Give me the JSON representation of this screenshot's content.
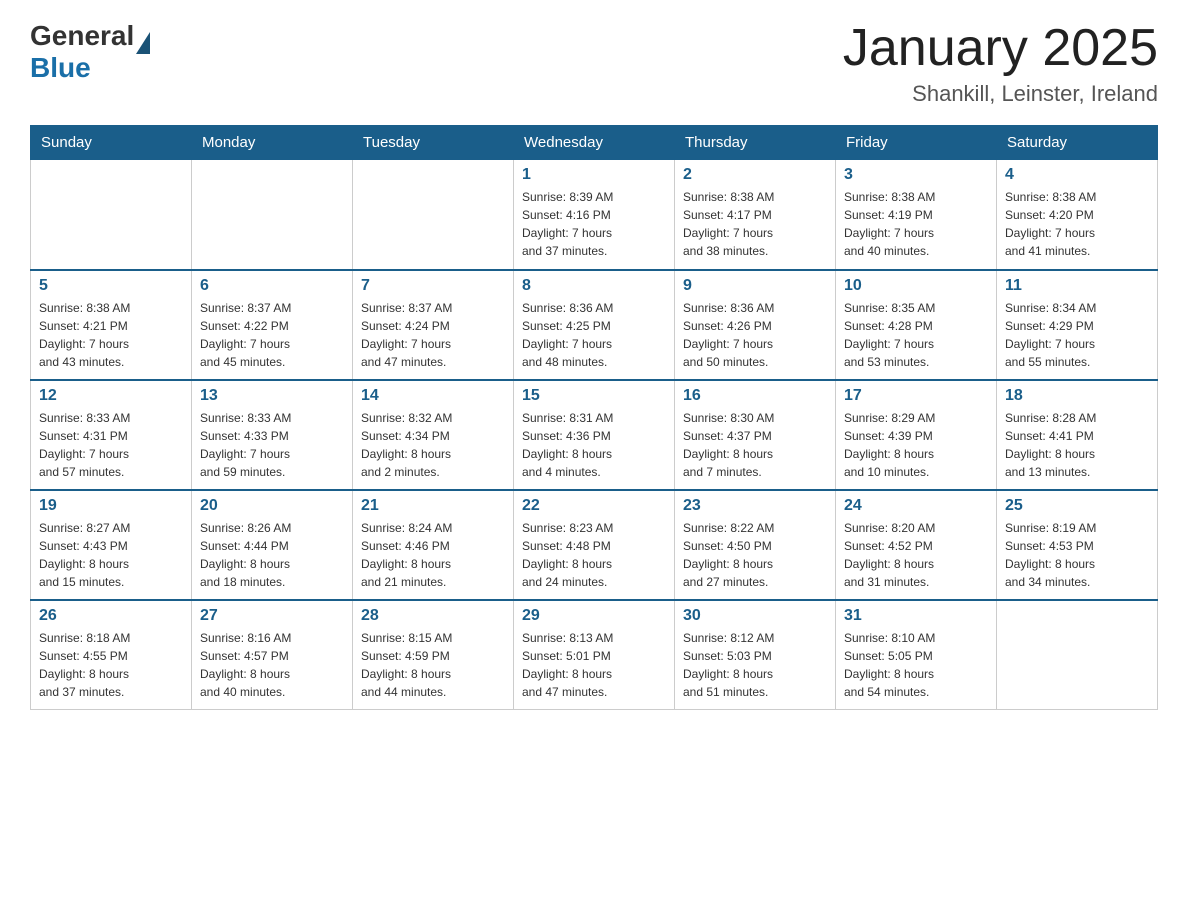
{
  "logo": {
    "general": "General",
    "blue": "Blue"
  },
  "title": "January 2025",
  "subtitle": "Shankill, Leinster, Ireland",
  "days_of_week": [
    "Sunday",
    "Monday",
    "Tuesday",
    "Wednesday",
    "Thursday",
    "Friday",
    "Saturday"
  ],
  "weeks": [
    [
      {
        "day": "",
        "info": ""
      },
      {
        "day": "",
        "info": ""
      },
      {
        "day": "",
        "info": ""
      },
      {
        "day": "1",
        "info": "Sunrise: 8:39 AM\nSunset: 4:16 PM\nDaylight: 7 hours\nand 37 minutes."
      },
      {
        "day": "2",
        "info": "Sunrise: 8:38 AM\nSunset: 4:17 PM\nDaylight: 7 hours\nand 38 minutes."
      },
      {
        "day": "3",
        "info": "Sunrise: 8:38 AM\nSunset: 4:19 PM\nDaylight: 7 hours\nand 40 minutes."
      },
      {
        "day": "4",
        "info": "Sunrise: 8:38 AM\nSunset: 4:20 PM\nDaylight: 7 hours\nand 41 minutes."
      }
    ],
    [
      {
        "day": "5",
        "info": "Sunrise: 8:38 AM\nSunset: 4:21 PM\nDaylight: 7 hours\nand 43 minutes."
      },
      {
        "day": "6",
        "info": "Sunrise: 8:37 AM\nSunset: 4:22 PM\nDaylight: 7 hours\nand 45 minutes."
      },
      {
        "day": "7",
        "info": "Sunrise: 8:37 AM\nSunset: 4:24 PM\nDaylight: 7 hours\nand 47 minutes."
      },
      {
        "day": "8",
        "info": "Sunrise: 8:36 AM\nSunset: 4:25 PM\nDaylight: 7 hours\nand 48 minutes."
      },
      {
        "day": "9",
        "info": "Sunrise: 8:36 AM\nSunset: 4:26 PM\nDaylight: 7 hours\nand 50 minutes."
      },
      {
        "day": "10",
        "info": "Sunrise: 8:35 AM\nSunset: 4:28 PM\nDaylight: 7 hours\nand 53 minutes."
      },
      {
        "day": "11",
        "info": "Sunrise: 8:34 AM\nSunset: 4:29 PM\nDaylight: 7 hours\nand 55 minutes."
      }
    ],
    [
      {
        "day": "12",
        "info": "Sunrise: 8:33 AM\nSunset: 4:31 PM\nDaylight: 7 hours\nand 57 minutes."
      },
      {
        "day": "13",
        "info": "Sunrise: 8:33 AM\nSunset: 4:33 PM\nDaylight: 7 hours\nand 59 minutes."
      },
      {
        "day": "14",
        "info": "Sunrise: 8:32 AM\nSunset: 4:34 PM\nDaylight: 8 hours\nand 2 minutes."
      },
      {
        "day": "15",
        "info": "Sunrise: 8:31 AM\nSunset: 4:36 PM\nDaylight: 8 hours\nand 4 minutes."
      },
      {
        "day": "16",
        "info": "Sunrise: 8:30 AM\nSunset: 4:37 PM\nDaylight: 8 hours\nand 7 minutes."
      },
      {
        "day": "17",
        "info": "Sunrise: 8:29 AM\nSunset: 4:39 PM\nDaylight: 8 hours\nand 10 minutes."
      },
      {
        "day": "18",
        "info": "Sunrise: 8:28 AM\nSunset: 4:41 PM\nDaylight: 8 hours\nand 13 minutes."
      }
    ],
    [
      {
        "day": "19",
        "info": "Sunrise: 8:27 AM\nSunset: 4:43 PM\nDaylight: 8 hours\nand 15 minutes."
      },
      {
        "day": "20",
        "info": "Sunrise: 8:26 AM\nSunset: 4:44 PM\nDaylight: 8 hours\nand 18 minutes."
      },
      {
        "day": "21",
        "info": "Sunrise: 8:24 AM\nSunset: 4:46 PM\nDaylight: 8 hours\nand 21 minutes."
      },
      {
        "day": "22",
        "info": "Sunrise: 8:23 AM\nSunset: 4:48 PM\nDaylight: 8 hours\nand 24 minutes."
      },
      {
        "day": "23",
        "info": "Sunrise: 8:22 AM\nSunset: 4:50 PM\nDaylight: 8 hours\nand 27 minutes."
      },
      {
        "day": "24",
        "info": "Sunrise: 8:20 AM\nSunset: 4:52 PM\nDaylight: 8 hours\nand 31 minutes."
      },
      {
        "day": "25",
        "info": "Sunrise: 8:19 AM\nSunset: 4:53 PM\nDaylight: 8 hours\nand 34 minutes."
      }
    ],
    [
      {
        "day": "26",
        "info": "Sunrise: 8:18 AM\nSunset: 4:55 PM\nDaylight: 8 hours\nand 37 minutes."
      },
      {
        "day": "27",
        "info": "Sunrise: 8:16 AM\nSunset: 4:57 PM\nDaylight: 8 hours\nand 40 minutes."
      },
      {
        "day": "28",
        "info": "Sunrise: 8:15 AM\nSunset: 4:59 PM\nDaylight: 8 hours\nand 44 minutes."
      },
      {
        "day": "29",
        "info": "Sunrise: 8:13 AM\nSunset: 5:01 PM\nDaylight: 8 hours\nand 47 minutes."
      },
      {
        "day": "30",
        "info": "Sunrise: 8:12 AM\nSunset: 5:03 PM\nDaylight: 8 hours\nand 51 minutes."
      },
      {
        "day": "31",
        "info": "Sunrise: 8:10 AM\nSunset: 5:05 PM\nDaylight: 8 hours\nand 54 minutes."
      },
      {
        "day": "",
        "info": ""
      }
    ]
  ]
}
